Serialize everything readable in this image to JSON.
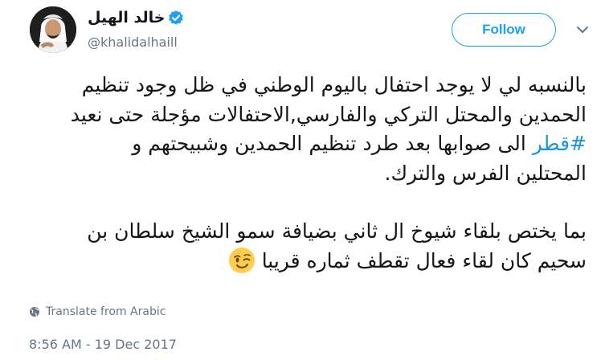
{
  "user": {
    "display_name": "خالد الهيل",
    "handle": "@khalidalhaill",
    "verified": true
  },
  "follow_button": {
    "label": "Follow"
  },
  "tweet": {
    "paragraph1": {
      "line1": "بالنسبه لي لا يوجد احتفال باليوم الوطني في ظل وجود تنظيم",
      "line2": "الحمدين والمحتل التركي والفارسي,الاحتفالات مؤجلة حتى نعيد",
      "line3_hashtag": "#قطر",
      "line3_rest": " الى صوابها بعد طرد تنظيم الحمدين وشبيحتهم و",
      "line4": "المحتلين الفرس والترك."
    },
    "paragraph2": {
      "line1": "بما يختص بلقاء شيوخ ال ثاني بضيافة سمو الشيخ سلطان بن",
      "line2": "سحيم كان لقاء فعال تقطف ثماره قريبا"
    }
  },
  "translate": {
    "label": "Translate from Arabic"
  },
  "timestamp": "8:56 AM - 19 Dec 2017",
  "colors": {
    "accent": "#1da1f2",
    "hashtag": "#1b95e0",
    "secondary_text": "#657786",
    "primary_text": "#14171a"
  },
  "icons": {
    "verified": "verified-badge-icon",
    "more": "chevron-down-icon",
    "translate": "globe-icon",
    "emoji": "winking-face-emoji"
  }
}
